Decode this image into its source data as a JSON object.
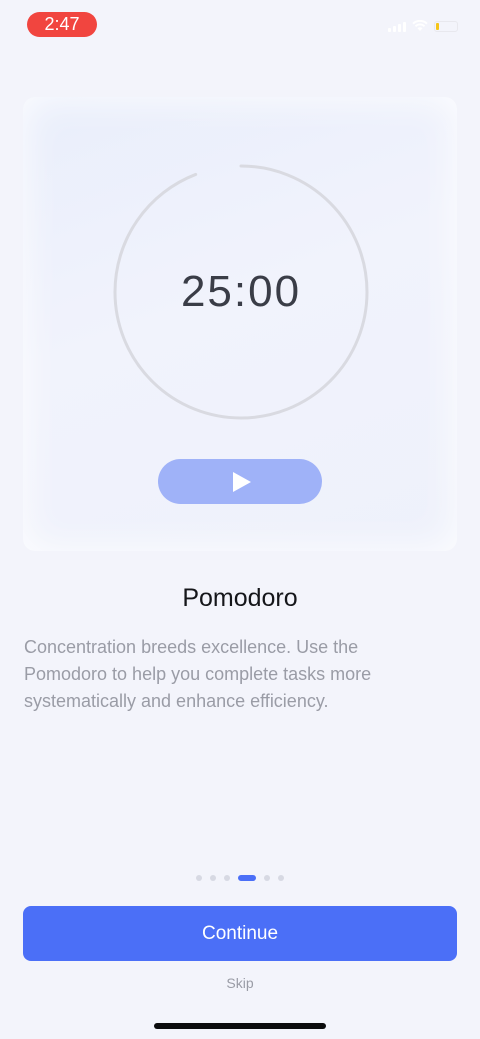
{
  "status_bar": {
    "time": "2:47",
    "time_badge_color": "#f1453f",
    "icons": [
      "signal-icon",
      "wifi-icon",
      "battery-icon"
    ]
  },
  "illustration": {
    "timer_display": "25:00",
    "play_icon": "play-icon",
    "accent_color": "#9fb2f8"
  },
  "onboarding": {
    "title": "Pomodoro",
    "description": "Concentration breeds excellence. Use the Pomodoro to help you complete tasks more systematically and enhance efficiency.",
    "page_indicator": {
      "total_pages": 6,
      "current_page": 4
    }
  },
  "actions": {
    "continue_label": "Continue",
    "skip_label": "Skip",
    "primary_color": "#4b6ff7"
  }
}
